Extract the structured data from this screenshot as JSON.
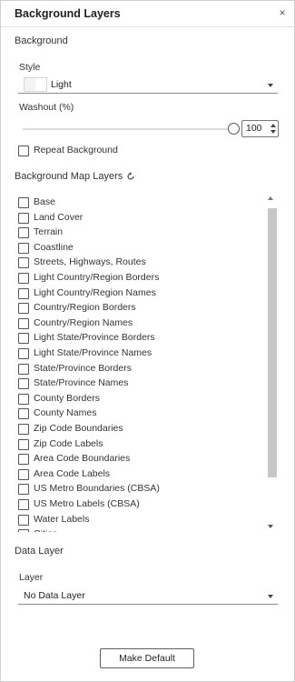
{
  "panel": {
    "title": "Background Layers",
    "close_symbol": "×"
  },
  "background": {
    "heading": "Background",
    "style_label": "Style",
    "style_value": "Light",
    "washout_label": "Washout (%)",
    "washout_value": "100",
    "washout_level_percent": 100,
    "repeat_label": "Repeat Background",
    "repeat_checked": false
  },
  "map_layers": {
    "heading": "Background Map Layers",
    "items": [
      {
        "label": "Base",
        "checked": false
      },
      {
        "label": "Land Cover",
        "checked": false
      },
      {
        "label": "Terrain",
        "checked": false
      },
      {
        "label": "Coastline",
        "checked": false
      },
      {
        "label": "Streets, Highways, Routes",
        "checked": false
      },
      {
        "label": "Light Country/Region Borders",
        "checked": false
      },
      {
        "label": "Light Country/Region Names",
        "checked": false
      },
      {
        "label": "Country/Region Borders",
        "checked": false
      },
      {
        "label": "Country/Region Names",
        "checked": false
      },
      {
        "label": "Light State/Province Borders",
        "checked": false
      },
      {
        "label": "Light State/Province Names",
        "checked": false
      },
      {
        "label": "State/Province Borders",
        "checked": false
      },
      {
        "label": "State/Province Names",
        "checked": false
      },
      {
        "label": "County Borders",
        "checked": false
      },
      {
        "label": "County Names",
        "checked": false
      },
      {
        "label": "Zip Code Boundaries",
        "checked": false
      },
      {
        "label": "Zip Code Labels",
        "checked": false
      },
      {
        "label": "Area Code Boundaries",
        "checked": false
      },
      {
        "label": "Area Code Labels",
        "checked": false
      },
      {
        "label": "US Metro Boundaries (CBSA)",
        "checked": false
      },
      {
        "label": "US Metro Labels (CBSA)",
        "checked": false
      },
      {
        "label": "Water Labels",
        "checked": false
      },
      {
        "label": "Cities",
        "checked": false
      }
    ]
  },
  "data_layer": {
    "heading": "Data Layer",
    "layer_label": "Layer",
    "layer_value": "No Data Layer"
  },
  "footer": {
    "make_default_label": "Make Default"
  }
}
